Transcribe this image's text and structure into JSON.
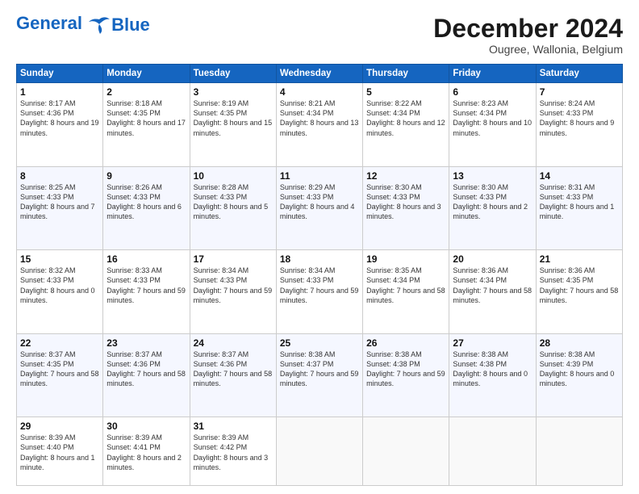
{
  "header": {
    "logo_line1": "General",
    "logo_line2": "Blue",
    "title": "December 2024",
    "subtitle": "Ougree, Wallonia, Belgium"
  },
  "columns": [
    "Sunday",
    "Monday",
    "Tuesday",
    "Wednesday",
    "Thursday",
    "Friday",
    "Saturday"
  ],
  "weeks": [
    [
      {
        "day": "1",
        "rise": "Sunrise: 8:17 AM",
        "set": "Sunset: 4:36 PM",
        "daylight": "Daylight: 8 hours and 19 minutes."
      },
      {
        "day": "2",
        "rise": "Sunrise: 8:18 AM",
        "set": "Sunset: 4:35 PM",
        "daylight": "Daylight: 8 hours and 17 minutes."
      },
      {
        "day": "3",
        "rise": "Sunrise: 8:19 AM",
        "set": "Sunset: 4:35 PM",
        "daylight": "Daylight: 8 hours and 15 minutes."
      },
      {
        "day": "4",
        "rise": "Sunrise: 8:21 AM",
        "set": "Sunset: 4:34 PM",
        "daylight": "Daylight: 8 hours and 13 minutes."
      },
      {
        "day": "5",
        "rise": "Sunrise: 8:22 AM",
        "set": "Sunset: 4:34 PM",
        "daylight": "Daylight: 8 hours and 12 minutes."
      },
      {
        "day": "6",
        "rise": "Sunrise: 8:23 AM",
        "set": "Sunset: 4:34 PM",
        "daylight": "Daylight: 8 hours and 10 minutes."
      },
      {
        "day": "7",
        "rise": "Sunrise: 8:24 AM",
        "set": "Sunset: 4:33 PM",
        "daylight": "Daylight: 8 hours and 9 minutes."
      }
    ],
    [
      {
        "day": "8",
        "rise": "Sunrise: 8:25 AM",
        "set": "Sunset: 4:33 PM",
        "daylight": "Daylight: 8 hours and 7 minutes."
      },
      {
        "day": "9",
        "rise": "Sunrise: 8:26 AM",
        "set": "Sunset: 4:33 PM",
        "daylight": "Daylight: 8 hours and 6 minutes."
      },
      {
        "day": "10",
        "rise": "Sunrise: 8:28 AM",
        "set": "Sunset: 4:33 PM",
        "daylight": "Daylight: 8 hours and 5 minutes."
      },
      {
        "day": "11",
        "rise": "Sunrise: 8:29 AM",
        "set": "Sunset: 4:33 PM",
        "daylight": "Daylight: 8 hours and 4 minutes."
      },
      {
        "day": "12",
        "rise": "Sunrise: 8:30 AM",
        "set": "Sunset: 4:33 PM",
        "daylight": "Daylight: 8 hours and 3 minutes."
      },
      {
        "day": "13",
        "rise": "Sunrise: 8:30 AM",
        "set": "Sunset: 4:33 PM",
        "daylight": "Daylight: 8 hours and 2 minutes."
      },
      {
        "day": "14",
        "rise": "Sunrise: 8:31 AM",
        "set": "Sunset: 4:33 PM",
        "daylight": "Daylight: 8 hours and 1 minute."
      }
    ],
    [
      {
        "day": "15",
        "rise": "Sunrise: 8:32 AM",
        "set": "Sunset: 4:33 PM",
        "daylight": "Daylight: 8 hours and 0 minutes."
      },
      {
        "day": "16",
        "rise": "Sunrise: 8:33 AM",
        "set": "Sunset: 4:33 PM",
        "daylight": "Daylight: 7 hours and 59 minutes."
      },
      {
        "day": "17",
        "rise": "Sunrise: 8:34 AM",
        "set": "Sunset: 4:33 PM",
        "daylight": "Daylight: 7 hours and 59 minutes."
      },
      {
        "day": "18",
        "rise": "Sunrise: 8:34 AM",
        "set": "Sunset: 4:33 PM",
        "daylight": "Daylight: 7 hours and 59 minutes."
      },
      {
        "day": "19",
        "rise": "Sunrise: 8:35 AM",
        "set": "Sunset: 4:34 PM",
        "daylight": "Daylight: 7 hours and 58 minutes."
      },
      {
        "day": "20",
        "rise": "Sunrise: 8:36 AM",
        "set": "Sunset: 4:34 PM",
        "daylight": "Daylight: 7 hours and 58 minutes."
      },
      {
        "day": "21",
        "rise": "Sunrise: 8:36 AM",
        "set": "Sunset: 4:35 PM",
        "daylight": "Daylight: 7 hours and 58 minutes."
      }
    ],
    [
      {
        "day": "22",
        "rise": "Sunrise: 8:37 AM",
        "set": "Sunset: 4:35 PM",
        "daylight": "Daylight: 7 hours and 58 minutes."
      },
      {
        "day": "23",
        "rise": "Sunrise: 8:37 AM",
        "set": "Sunset: 4:36 PM",
        "daylight": "Daylight: 7 hours and 58 minutes."
      },
      {
        "day": "24",
        "rise": "Sunrise: 8:37 AM",
        "set": "Sunset: 4:36 PM",
        "daylight": "Daylight: 7 hours and 58 minutes."
      },
      {
        "day": "25",
        "rise": "Sunrise: 8:38 AM",
        "set": "Sunset: 4:37 PM",
        "daylight": "Daylight: 7 hours and 59 minutes."
      },
      {
        "day": "26",
        "rise": "Sunrise: 8:38 AM",
        "set": "Sunset: 4:38 PM",
        "daylight": "Daylight: 7 hours and 59 minutes."
      },
      {
        "day": "27",
        "rise": "Sunrise: 8:38 AM",
        "set": "Sunset: 4:38 PM",
        "daylight": "Daylight: 8 hours and 0 minutes."
      },
      {
        "day": "28",
        "rise": "Sunrise: 8:38 AM",
        "set": "Sunset: 4:39 PM",
        "daylight": "Daylight: 8 hours and 0 minutes."
      }
    ],
    [
      {
        "day": "29",
        "rise": "Sunrise: 8:39 AM",
        "set": "Sunset: 4:40 PM",
        "daylight": "Daylight: 8 hours and 1 minute."
      },
      {
        "day": "30",
        "rise": "Sunrise: 8:39 AM",
        "set": "Sunset: 4:41 PM",
        "daylight": "Daylight: 8 hours and 2 minutes."
      },
      {
        "day": "31",
        "rise": "Sunrise: 8:39 AM",
        "set": "Sunset: 4:42 PM",
        "daylight": "Daylight: 8 hours and 3 minutes."
      },
      null,
      null,
      null,
      null
    ]
  ]
}
